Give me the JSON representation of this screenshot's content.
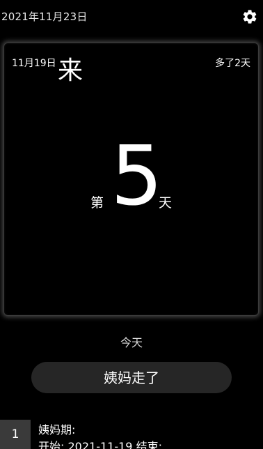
{
  "header": {
    "date": "2021年11月23日",
    "settings_icon": "gear-icon"
  },
  "card": {
    "start_date": "11月19日",
    "status": "来",
    "overdue": "多了2天",
    "day_prefix": "第",
    "day_number": "5",
    "day_suffix": "天"
  },
  "today_label": "今天",
  "action_button": "姨妈走了",
  "record": {
    "index": "1",
    "title": "姨妈期:",
    "start_label": "开始:",
    "start_value": "2021-11-19,",
    "end_label": "结束:"
  },
  "colors": {
    "background": "#000000",
    "button_bg": "#262626",
    "index_bg": "#3a3a3a",
    "text": "#ffffff"
  }
}
